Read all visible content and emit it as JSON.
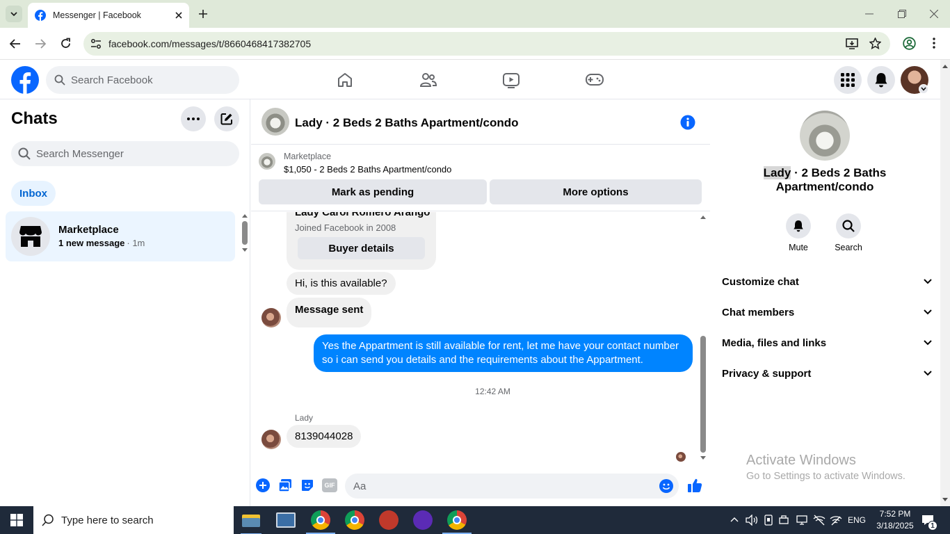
{
  "browser": {
    "tab_title": "Messenger | Facebook",
    "url": "facebook.com/messages/t/8660468417382705"
  },
  "fb_header": {
    "search_placeholder": "Search Facebook"
  },
  "chats": {
    "title": "Chats",
    "search_placeholder": "Search Messenger",
    "inbox_label": "Inbox",
    "conversations": [
      {
        "name": "Marketplace",
        "preview": "1 new message",
        "time": "· 1m"
      }
    ]
  },
  "chat": {
    "title": "Lady · 2 Beds 2 Baths Apartment/condo",
    "marketplace_label": "Marketplace",
    "listing": "$1,050 - 2 Beds 2 Baths Apartment/condo",
    "mark_pending": "Mark as pending",
    "more_options": "More options",
    "buyer_name_partial": "Lady Carol Romero Arango",
    "joined": "Joined Facebook in 2008",
    "buyer_details": "Buyer details",
    "messages": {
      "m1": "Hi, is this available?",
      "m2": "Message sent",
      "m3": "Yes the Appartment is still available for rent, let me have your contact number so i can send you details and the requirements about the Appartment.",
      "timestamp": "12:42 AM",
      "sender": "Lady",
      "m4": "8139044028"
    },
    "composer_placeholder": "Aa"
  },
  "info_panel": {
    "name_highlight": "Lady",
    "name_rest": " · 2 Beds 2 Baths",
    "name_line2": "Apartment/condo",
    "mute": "Mute",
    "search": "Search",
    "sections": [
      "Customize chat",
      "Chat members",
      "Media, files and links",
      "Privacy & support"
    ]
  },
  "watermark": {
    "title": "Activate Windows",
    "subtitle": "Go to Settings to activate Windows."
  },
  "taskbar": {
    "search_placeholder": "Type here to search",
    "lang": "ENG",
    "time": "7:52 PM",
    "date": "3/18/2025",
    "notifications": "1"
  },
  "colors": {
    "fb_blue": "#0866ff",
    "bubble_out": "#0084ff",
    "chrome_bg": "#dfe9d9"
  }
}
